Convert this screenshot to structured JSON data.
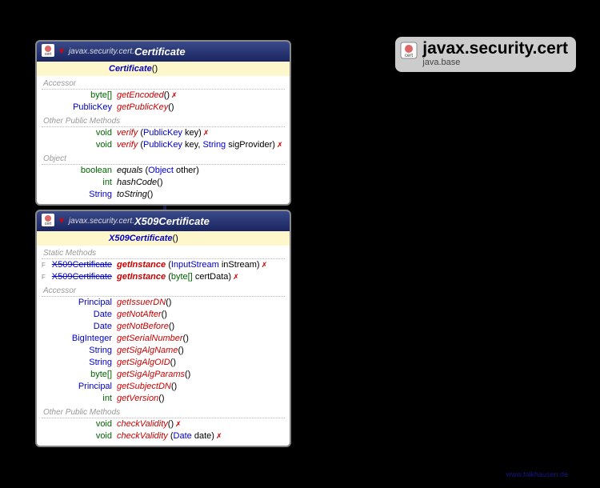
{
  "package": {
    "name": "javax.security.cert",
    "module": "java.base"
  },
  "footer": "www.falkhausen.de",
  "classes": {
    "certificate": {
      "pkg": "javax.security.cert.",
      "name": "Certificate",
      "ctor": "Certificate",
      "ctorParams": "()",
      "sections": {
        "accessor": "Accessor",
        "other": "Other Public Methods",
        "object": "Object"
      },
      "methods": {
        "getEncoded": {
          "ret": "byte[]",
          "name": "getEncoded",
          "params": "()",
          "exc": true
        },
        "getPublicKey": {
          "ret": "PublicKey",
          "name": "getPublicKey",
          "params": "()"
        },
        "verify1": {
          "ret": "void",
          "name": "verify",
          "p1type": "PublicKey",
          "p1name": "key",
          "exc": true
        },
        "verify2": {
          "ret": "void",
          "name": "verify",
          "p1type": "PublicKey",
          "p1name": "key",
          "p2type": "String",
          "p2name": "sigProvider",
          "exc": true
        },
        "equals": {
          "ret": "boolean",
          "name": "equals",
          "p1type": "Object",
          "p1name": "other"
        },
        "hashCode": {
          "ret": "int",
          "name": "hashCode",
          "params": "()"
        },
        "toString": {
          "ret": "String",
          "name": "toString",
          "params": "()"
        }
      }
    },
    "x509": {
      "pkg": "javax.security.cert.",
      "name": "X509Certificate",
      "ctor": "X509Certificate",
      "ctorParams": "()",
      "sections": {
        "static": "Static Methods",
        "accessor": "Accessor",
        "other": "Other Public Methods"
      },
      "methods": {
        "getInstance1": {
          "ret": "X509Certificate",
          "name": "getInstance",
          "p1type": "InputStream",
          "p1name": "inStream",
          "exc": true,
          "final": true
        },
        "getInstance2": {
          "ret": "X509Certificate",
          "name": "getInstance",
          "p1type": "byte[]",
          "p1name": "certData",
          "exc": true,
          "final": true
        },
        "getIssuerDN": {
          "ret": "Principal",
          "name": "getIssuerDN",
          "params": "()"
        },
        "getNotAfter": {
          "ret": "Date",
          "name": "getNotAfter",
          "params": "()"
        },
        "getNotBefore": {
          "ret": "Date",
          "name": "getNotBefore",
          "params": "()"
        },
        "getSerialNumber": {
          "ret": "BigInteger",
          "name": "getSerialNumber",
          "params": "()"
        },
        "getSigAlgName": {
          "ret": "String",
          "name": "getSigAlgName",
          "params": "()"
        },
        "getSigAlgOID": {
          "ret": "String",
          "name": "getSigAlgOID",
          "params": "()"
        },
        "getSigAlgParams": {
          "ret": "byte[]",
          "name": "getSigAlgParams",
          "params": "()"
        },
        "getSubjectDN": {
          "ret": "Principal",
          "name": "getSubjectDN",
          "params": "()"
        },
        "getVersion": {
          "ret": "int",
          "name": "getVersion",
          "params": "()"
        },
        "checkValidity1": {
          "ret": "void",
          "name": "checkValidity",
          "params": "()",
          "exc": true
        },
        "checkValidity2": {
          "ret": "void",
          "name": "checkValidity",
          "p1type": "Date",
          "p1name": "date",
          "exc": true
        }
      }
    }
  }
}
